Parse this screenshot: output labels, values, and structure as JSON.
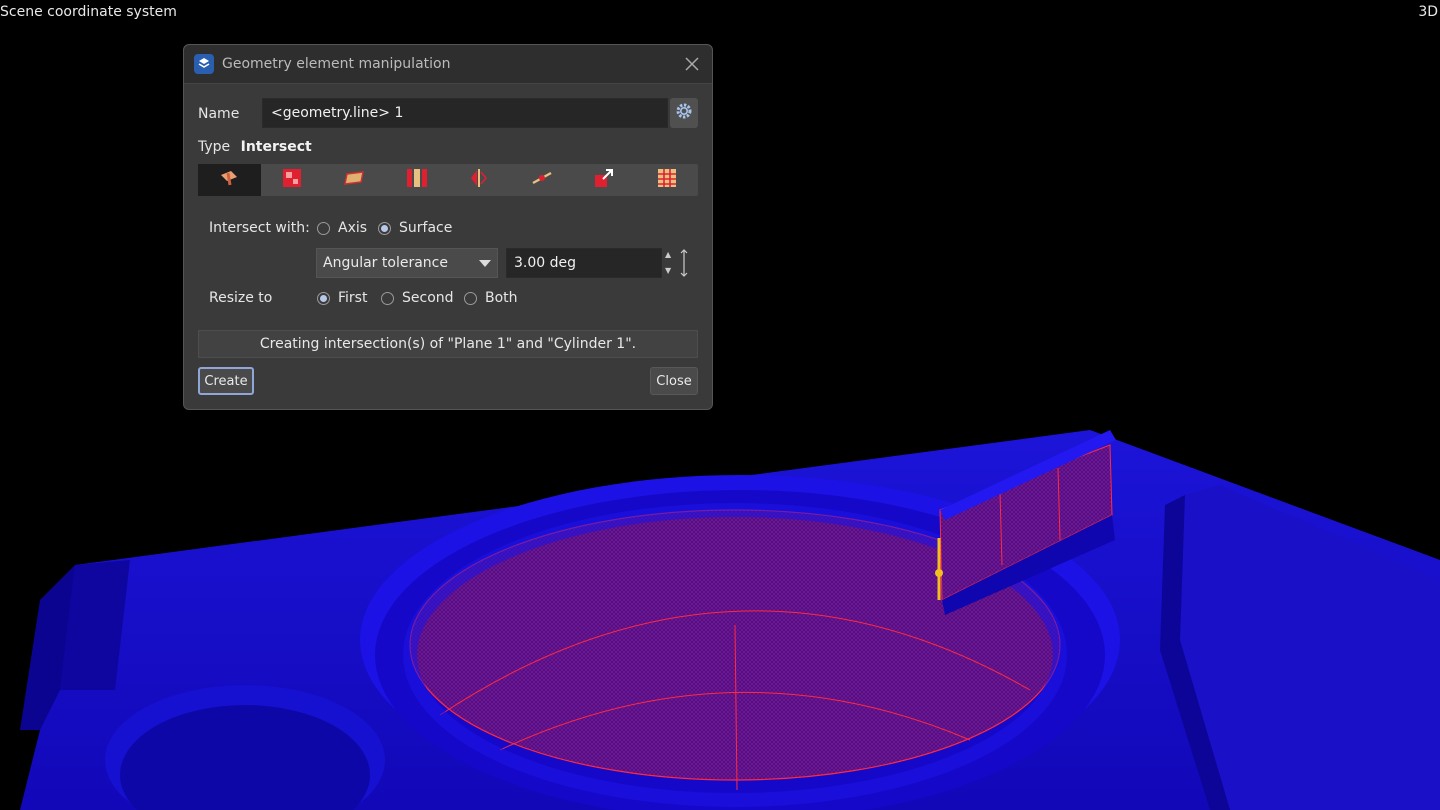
{
  "viewport": {
    "coord_system_label": "Scene coordinate system",
    "view_mode": "3D"
  },
  "dialog": {
    "title": "Geometry element manipulation",
    "icons": {
      "app": "app-logo-icon",
      "close": "close-icon",
      "settings": "gear-icon"
    },
    "name_label": "Name",
    "name_value": "<geometry.line> 1",
    "type_label": "Type",
    "type_value": "Intersect",
    "toolbar": [
      {
        "icon": "intersect-icon",
        "active": true
      },
      {
        "icon": "squares-icon",
        "active": false
      },
      {
        "icon": "plane-icon",
        "active": false
      },
      {
        "icon": "columns-icon",
        "active": false
      },
      {
        "icon": "mirror-icon",
        "active": false
      },
      {
        "icon": "line-through-icon",
        "active": false
      },
      {
        "icon": "resize-icon",
        "active": false
      },
      {
        "icon": "grid-icon",
        "active": false
      }
    ],
    "intersect_with_label": "Intersect with:",
    "intersect_options": [
      {
        "label": "Axis",
        "checked": false
      },
      {
        "label": "Surface",
        "checked": true
      }
    ],
    "tolerance_select": "Angular tolerance",
    "tolerance_value": "3.00 deg",
    "resize_label": "Resize to",
    "resize_options": [
      {
        "label": "First",
        "checked": true
      },
      {
        "label": "Second",
        "checked": false
      },
      {
        "label": "Both",
        "checked": false
      }
    ],
    "status_message": "Creating intersection(s) of \"Plane 1\" and \"Cylinder 1\".",
    "create_button": "Create",
    "close_button": "Close"
  },
  "colors": {
    "model": "#1a12e0",
    "highlight": "#ff2a40",
    "accent": "#f0c020",
    "dialog_bg": "#3a3a3a"
  }
}
